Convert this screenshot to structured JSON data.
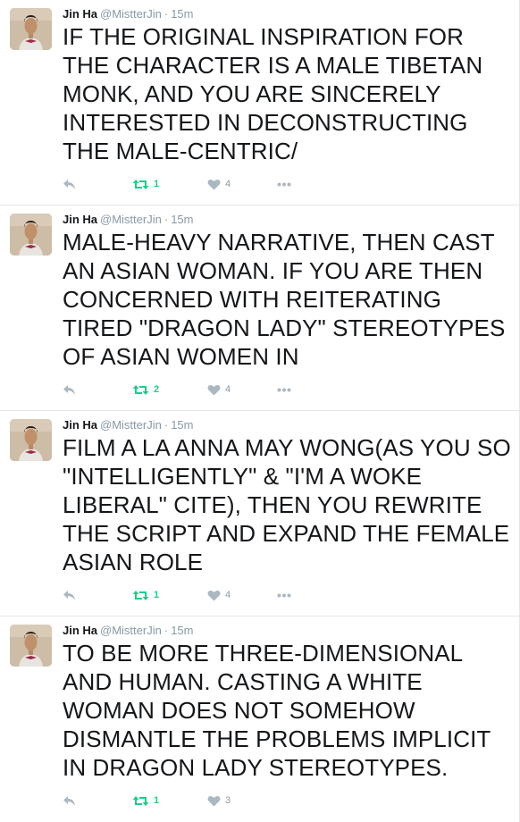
{
  "tweets": [
    {
      "name": "Jin Ha",
      "handle": "@MistterJin",
      "separator": "·",
      "time": "15m",
      "text": "IF THE ORIGINAL INSPIRATION FOR THE CHARACTER IS A MALE TIBETAN MONK, AND YOU ARE SINCERELY INTERESTED IN DECONSTRUCTING THE MALE-CENTRIC/",
      "retweets": "1",
      "likes": "4"
    },
    {
      "name": "Jin Ha",
      "handle": "@MistterJin",
      "separator": "·",
      "time": "15m",
      "text": "MALE-HEAVY NARRATIVE, THEN CAST AN ASIAN WOMAN. IF YOU ARE THEN CONCERNED WITH REITERATING TIRED \"DRAGON LADY\" STEREOTYPES OF ASIAN WOMEN IN",
      "retweets": "2",
      "likes": "4"
    },
    {
      "name": "Jin Ha",
      "handle": "@MistterJin",
      "separator": "·",
      "time": "15m",
      "text": "FILM A LA ANNA MAY WONG(AS YOU SO \"INTELLIGENTLY\" & \"I'M A WOKE LIBERAL\" CITE), THEN YOU REWRITE THE SCRIPT AND EXPAND THE FEMALE ASIAN ROLE",
      "retweets": "1",
      "likes": "4"
    },
    {
      "name": "Jin Ha",
      "handle": "@MistterJin",
      "separator": "·",
      "time": "15m",
      "text": "TO BE MORE THREE-DIMENSIONAL AND HUMAN. CASTING A WHITE WOMAN DOES NOT SOMEHOW DISMANTLE THE PROBLEMS IMPLICIT IN DRAGON LADY STEREOTYPES.",
      "retweets": "1",
      "likes": "3"
    }
  ],
  "icons": {
    "reply": "reply-icon",
    "retweet": "retweet-icon",
    "like": "heart-icon",
    "more": "more-icon"
  },
  "colors": {
    "retweet_active": "#19cf86",
    "action_gray": "#aab8c2",
    "meta_gray": "#8899a6"
  }
}
